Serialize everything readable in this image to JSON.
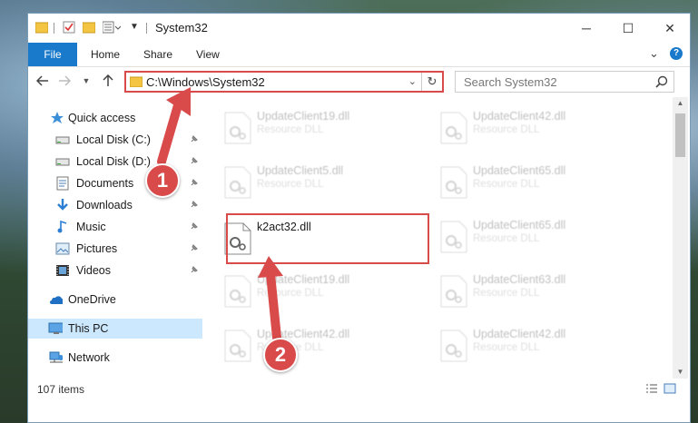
{
  "window": {
    "title": "System32",
    "minimize_glyph": "─",
    "maximize_glyph": "☐",
    "close_glyph": "✕"
  },
  "ribbon": {
    "tabs": [
      "File",
      "Home",
      "Share",
      "View"
    ],
    "help_glyph": "?",
    "expand_glyph": "⌄"
  },
  "address": {
    "path": "C:\\Windows\\System32",
    "dropdown_glyph": "⌄",
    "refresh_glyph": "↻"
  },
  "search": {
    "placeholder": "Search System32"
  },
  "sidebar": {
    "items": [
      {
        "label": "Quick access",
        "icon": "star-icon",
        "pinned": false
      },
      {
        "label": "Local Disk (C:)",
        "icon": "drive-icon",
        "pinned": true
      },
      {
        "label": "Local Disk (D:)",
        "icon": "drive-icon",
        "pinned": true
      },
      {
        "label": "Documents",
        "icon": "documents-icon",
        "pinned": true
      },
      {
        "label": "Downloads",
        "icon": "download-icon",
        "pinned": true
      },
      {
        "label": "Music",
        "icon": "music-icon",
        "pinned": true
      },
      {
        "label": "Pictures",
        "icon": "pictures-icon",
        "pinned": true
      },
      {
        "label": "Videos",
        "icon": "videos-icon",
        "pinned": true
      },
      {
        "label": "OneDrive",
        "icon": "cloud-icon",
        "pinned": false
      },
      {
        "label": "This PC",
        "icon": "computer-icon",
        "pinned": false,
        "selected": true
      },
      {
        "label": "Network",
        "icon": "network-icon",
        "pinned": false
      }
    ],
    "pin_glyph": "📌"
  },
  "files": {
    "left_column": [
      {
        "name": "UpdateClient19.dll",
        "type": "Resource DLL",
        "faded": true
      },
      {
        "name": "UpdateClient5.dll",
        "type": "Resource DLL",
        "faded": true
      },
      {
        "name": "k2act32.dll",
        "type": "",
        "faded": false
      },
      {
        "name": "UpdateClient19.dll",
        "type": "Resource DLL",
        "faded": true
      },
      {
        "name": "UpdateClient42.dll",
        "type": "Resource DLL",
        "faded": true
      }
    ],
    "right_column": [
      {
        "name": "UpdateClient42.dll",
        "type": "Resource DLL",
        "faded": true
      },
      {
        "name": "UpdateClient65.dll",
        "type": "Resource DLL",
        "faded": true
      },
      {
        "name": "UpdateClient65.dll",
        "type": "Resource DLL",
        "faded": true
      },
      {
        "name": "UpdateClient63.dll",
        "type": "Resource DLL",
        "faded": true
      },
      {
        "name": "UpdateClient42.dll",
        "type": "Resource DLL",
        "faded": true
      }
    ]
  },
  "status": {
    "item_count": "107 items"
  },
  "callouts": [
    "1",
    "2"
  ],
  "colors": {
    "accent": "#1979ca",
    "highlight": "#d94a4a",
    "selected": "#cce8ff"
  }
}
